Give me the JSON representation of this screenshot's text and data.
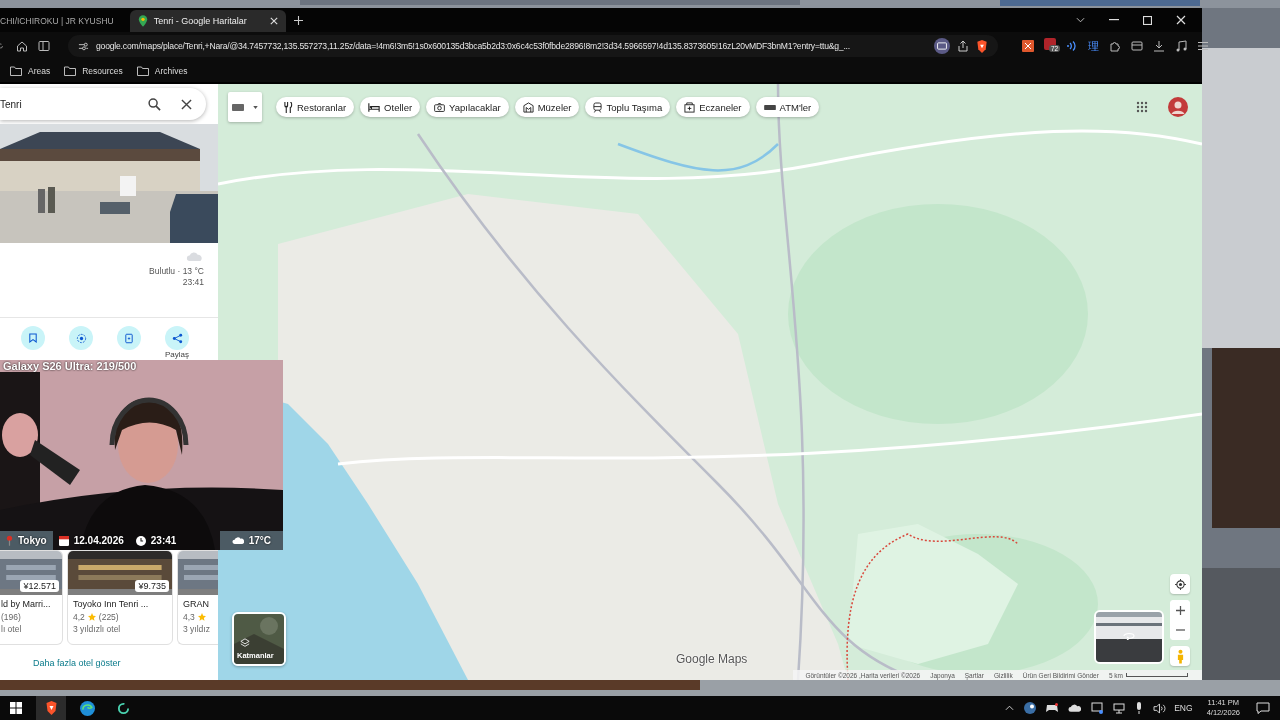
{
  "browser": {
    "tabs": [
      {
        "title": "CHI/ICHIROKU | JR KYUSHU",
        "selected": false
      },
      {
        "title": "Tenri - Google Haritalar",
        "selected": true
      }
    ],
    "url": "google.com/maps/place/Tenri,+Nara/@34.7457732,135.557273,11.25z/data=!4m6!3m5!1s0x600135d3bca5b2d3:0x6c4c53f0fbde2896!8m2!3d34.5966597!4d135.8373605!16zL20vMDF3bnM1?entry=ttu&g_...",
    "extension_badge": "72",
    "extension_glyph": "理",
    "bookmarks": [
      "Areas",
      "Resources",
      "Archives"
    ]
  },
  "place_panel": {
    "search": {
      "value": "Tenri"
    },
    "weather": "Bulutlu · 13 °C",
    "weather_time": "23:41",
    "share_label": "Paylaş",
    "hotels": [
      {
        "name": "ld by Marri...",
        "reviews": "(196)",
        "class": "lı otel",
        "price": "¥12.571"
      },
      {
        "name": "Toyoko Inn Tenri ...",
        "rating": "4,2",
        "reviews": "(225)",
        "class": "3 yıldızlı otel",
        "price": "¥9.735"
      },
      {
        "name": "GRAN",
        "rating": "4,3",
        "class": "3 yıldız"
      }
    ],
    "more_hotels": "Daha fazla otel göster"
  },
  "stream_overlay": {
    "header": "Galaxy S26 Ultra: 219/500",
    "city": "Tokyo",
    "date": "12.04.2026",
    "time": "23:41",
    "temperature": "17°C"
  },
  "map": {
    "chips": [
      {
        "label": "Restoranlar",
        "kind": "restaurant"
      },
      {
        "label": "Oteller",
        "kind": "hotel"
      },
      {
        "label": "Yapılacaklar",
        "kind": "camera"
      },
      {
        "label": "Müzeler",
        "kind": "museum"
      },
      {
        "label": "Toplu Taşıma",
        "kind": "transit"
      },
      {
        "label": "Eczaneler",
        "kind": "pharmacy"
      },
      {
        "label": "ATM'ler",
        "kind": "atm"
      }
    ],
    "layers_label": "Katmanlar",
    "logo": "Google Maps",
    "attribution": [
      "Görüntüler ©2026 ,Harita verileri ©2026",
      "Japonya",
      "Şartlar",
      "Gizlilik",
      "Ürün Geri Bildirimi Gönder"
    ],
    "scale": "5 km"
  },
  "taskbar": {
    "language": "ENG",
    "time": "11:41 PM",
    "date": "4/12/2026"
  }
}
